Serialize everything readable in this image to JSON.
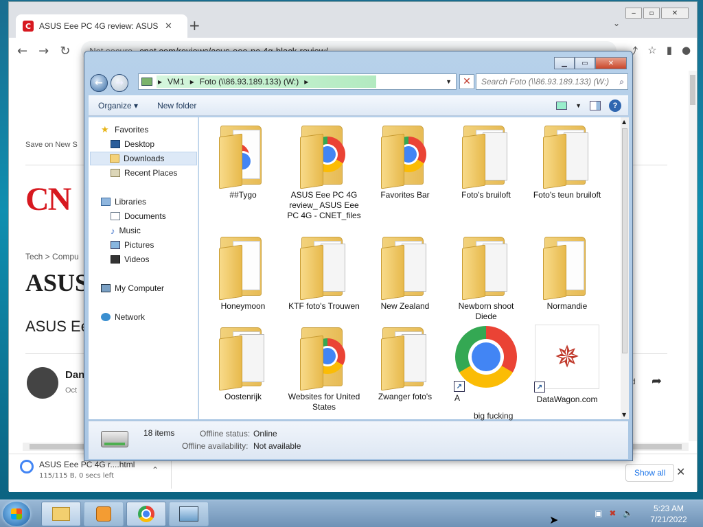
{
  "browser": {
    "tab_title": "ASUS Eee PC 4G review: ASUS Ee",
    "tab_favicon": "C",
    "new_tab": "+",
    "tab_search": "⌄",
    "url_security": "Not secure",
    "url": "cnet.com/reviews/asus-eee-pc-4g-black-review/",
    "window_buttons": [
      "‒",
      "▫",
      "✕"
    ]
  },
  "page": {
    "save_on": "Save on New S",
    "logo": "CN",
    "breadcrumb": "Tech > Compu",
    "headline": "ASUS",
    "subheadline": "ASUS Ee",
    "author": "Dan",
    "date": "Oct",
    "share_suffix": "d"
  },
  "downloads": {
    "file_name": "ASUS Eee PC 4G r....html",
    "status": "115/115 B, 0 secs left",
    "show_all": "Show all"
  },
  "explorer": {
    "breadcrumb": [
      "VM1",
      "Foto (\\\\86.93.189.133) (W:)"
    ],
    "search_placeholder": "Search Foto (\\\\86.93.189.133) (W:)",
    "toolbar": {
      "organize": "Organize",
      "new_folder": "New folder"
    },
    "nav": {
      "favorites": "Favorites",
      "desktop": "Desktop",
      "downloads": "Downloads",
      "recent_places": "Recent Places",
      "libraries": "Libraries",
      "documents": "Documents",
      "music": "Music",
      "pictures": "Pictures",
      "videos": "Videos",
      "my_computer": "My Computer",
      "network": "Network"
    },
    "items": [
      "##Tygo",
      "ASUS Eee PC 4G review_ ASUS Eee PC 4G - CNET_files",
      "Favorites Bar",
      "Foto's bruiloft",
      "Foto's teun bruiloft",
      "Honeymoon",
      "KTF foto's Trouwen",
      "New Zealand",
      "Newborn shoot Diede",
      "Normandie",
      "Oostenrijk",
      "Websites for United States",
      "Zwanger foto's",
      "A",
      "DataWagon.com"
    ],
    "partial_item": "big fucking",
    "status": {
      "count": "18 items",
      "offline_status_label": "Offline status:",
      "offline_status": "Online",
      "offline_availability_label": "Offline availability:",
      "offline_availability": "Not available"
    }
  },
  "taskbar": {
    "time": "5:23 AM",
    "date": "7/21/2022"
  }
}
